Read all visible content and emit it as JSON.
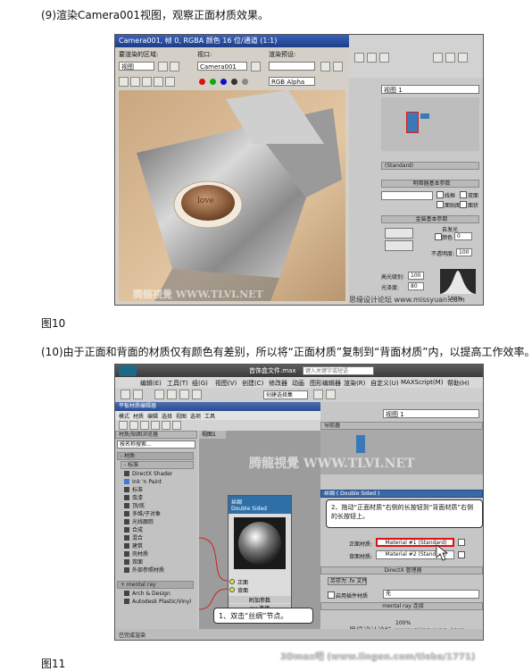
{
  "captions": {
    "step9": "(9)渲染Camera001视图，观察正面材质效果。",
    "fig10": "图10",
    "step10": "(10)由于正面和背面的材质仅有颜色有差别，所以将“正面材质”复制到“背面材质”内，以提高工作效率。",
    "fig11": "图11"
  },
  "fig10": {
    "title": "Camera001, 帧 0, RGBA 颜色 16 位/通道 (1:1)",
    "area_label": "要渲染的区域:",
    "area_value": "视图",
    "viewport_label": "视口:",
    "viewport_value": "Camera001",
    "preset_label": "渲染预设:",
    "preset_value": "",
    "channel_value": "RGB Alpha",
    "render_text": "love",
    "watermark": "腾龍視覺 WWW.TLVI.NET",
    "watermark2": "思缘设计论坛 www.missyuan.com",
    "right": {
      "view_dropdown": "视图 1",
      "standard_head": "(Standard)",
      "shader_head": "明暗器基本参数",
      "wire": "线框",
      "two_sided": "双面",
      "face_map": "面贴图",
      "faceted": "面状",
      "basic_head": "金属基本参数",
      "self_illum": "自发光",
      "color": "颜色",
      "color_value": "0",
      "opacity": "不透明度:",
      "opacity_value": "100",
      "specular_level": "高光级别:",
      "specular_level_value": "100",
      "glossiness": "光泽度:",
      "glossiness_value": "80",
      "zoom": "100%"
    }
  },
  "fig11": {
    "title": "首饰盒文件.max",
    "search_placeholder": "键入关键字或短语",
    "menus": [
      "编辑(E)",
      "工具(T)",
      "组(G)",
      "视图(V)",
      "创建(C)",
      "修改器",
      "动画",
      "图形编辑器",
      "渲染(R)",
      "自定义(U)",
      "MAXScript(M)",
      "帮助(H)"
    ],
    "selection_set": "创建选择集",
    "editor_title": "平板材质编辑器",
    "editor_menu": [
      "模式",
      "材质",
      "编辑",
      "选择",
      "视图",
      "选项",
      "工具"
    ],
    "browser_head": "材质/贴图浏览器",
    "browser_search": "按名称搜索...",
    "group_material": "- 材质",
    "group_standard": "- 标准",
    "materials": [
      "DirectX Shader",
      "Ink 'n Paint",
      "标准",
      "虫漆",
      "顶/底",
      "多维/子对象",
      "光线跟踪",
      "合成",
      "混合",
      "建筑",
      "壳材质",
      "双面",
      "外部参照材质"
    ],
    "group_mental": "+ mental ray",
    "group_other": [
      "Arch & Design",
      "Autodesk Plastic/Vinyl"
    ],
    "view_tab": "视图1",
    "node_title": "丝绸",
    "node_subtitle": "Double Sided",
    "slot_front": "正面",
    "slot_back": "背面",
    "slot_extra": "附加参数",
    "slot_extra2": "mr 连接",
    "status": "已完成渲染",
    "right": {
      "view_dropdown": "视图 1",
      "nav_head": "导航器",
      "name_field": "丝绸 ( Double Sided )",
      "callout2": "2、拖动“正面材质”右侧的长按钮到“背面材质”右侧的长按钮上。",
      "front_label": "正面材质:",
      "front_value": "Material #1 (Standard)",
      "back_label": "背面材质:",
      "back_value": "Material #2 (Standard)",
      "directx_head": "DirectX 管理器",
      "save_fx": "另存为 .fx 文件",
      "use_plugin": "启用插件材质",
      "none": "无",
      "mr_head": "mental ray 连接",
      "zoom": "100%"
    },
    "callout1": "1、双击“丝绸”节点。",
    "watermark": "腾龍視覺 WWW.TLVI.NET",
    "watermark2": "思缘设计论坛 www.missyuan.com",
    "bottom_watermark": "3Dmax吧 (www.lingen.com/tieba/1771)"
  }
}
